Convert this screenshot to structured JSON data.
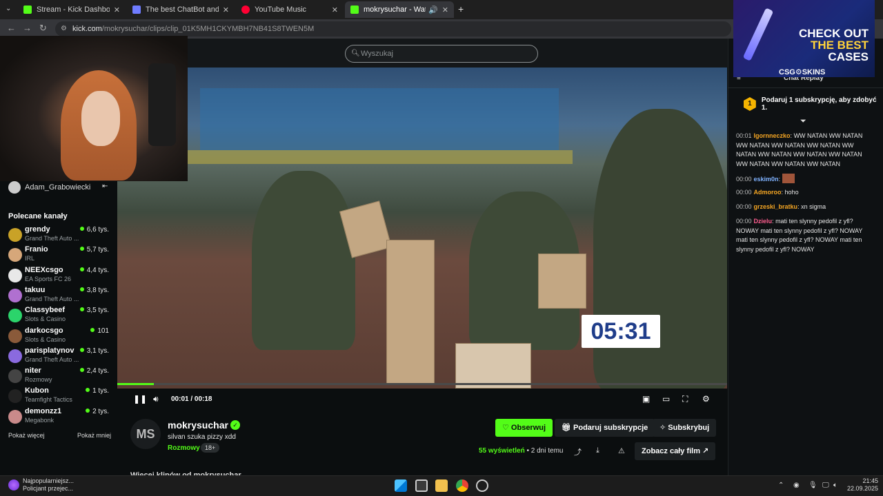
{
  "browser": {
    "tabs": [
      {
        "title": "Stream - Kick Dashboard",
        "favicon_color": "#53fc18",
        "active": false
      },
      {
        "title": "The best ChatBot and Widgets",
        "favicon_color": "#6f7cff",
        "active": false
      },
      {
        "title": "YouTube Music",
        "favicon_color": "#ff0033",
        "active": false
      },
      {
        "title": "mokrysuchar - Watch clips",
        "favicon_color": "#53fc18",
        "active": true
      }
    ],
    "url_host": "kick.com",
    "url_path": "/mokrysuchar/clips/clip_01K5MH1CKYMBH7NB41S8TWEN5M"
  },
  "search": {
    "placeholder": "Wyszukaj"
  },
  "sidebar": {
    "user": "Adam_Grabowiecki",
    "recommended_title": "Polecane kanały",
    "channels": [
      {
        "name": "grendy",
        "category": "Grand Theft Auto ...",
        "viewers": "6,6 tys.",
        "color": "#c9a227"
      },
      {
        "name": "Franio",
        "category": "IRL",
        "viewers": "5,7 tys.",
        "color": "#d6a77a"
      },
      {
        "name": "NEEXcsgo",
        "category": "EA Sports FC 26",
        "viewers": "4,4 tys.",
        "color": "#e8e8e8"
      },
      {
        "name": "takuu",
        "category": "Grand Theft Auto ...",
        "viewers": "3,8 tys.",
        "color": "#b070d0"
      },
      {
        "name": "Classybeef",
        "category": "Slots & Casino",
        "viewers": "3,5 tys.",
        "color": "#2bd46b"
      },
      {
        "name": "darkocsgo",
        "category": "Slots & Casino",
        "viewers": "101",
        "color": "#8a5a3a"
      },
      {
        "name": "parisplatynov",
        "category": "Grand Theft Auto ...",
        "viewers": "3,1 tys.",
        "color": "#8a6adf"
      },
      {
        "name": "niter",
        "category": "Rozmowy",
        "viewers": "2,4 tys.",
        "color": "#444444"
      },
      {
        "name": "Kubon",
        "category": "Teamfight Tactics",
        "viewers": "1 tys.",
        "color": "#222222"
      },
      {
        "name": "demonzz1",
        "category": "Megabonk",
        "viewers": "2 tys.",
        "color": "#c98a8a"
      }
    ],
    "show_more": "Pokaż więcej",
    "show_less": "Pokaż mniej"
  },
  "player": {
    "overlay_timer": "05:31",
    "current_time": "00:01",
    "separator": "/",
    "duration": "00:18",
    "progress": 0.06
  },
  "clip": {
    "channel_initials": "MS",
    "channel_name": "mokrysuchar",
    "title": "silvan szuka pizzy xdd",
    "category": "Rozmowy",
    "age_rating": "18+",
    "views_count": "55",
    "views_label": "wyświetleń",
    "age": "2 dni temu",
    "more_clips": "Więcej klipów od mokrysuchar"
  },
  "actions": {
    "follow": "Obserwuj",
    "gift": "Podaruj subskrypcje",
    "subscribe": "Subskrybuj",
    "watch_full": "Zobacz cały film"
  },
  "ad": {
    "line1": "CHECK OUT",
    "line2": "THE BEST",
    "line3": "CASES",
    "brand": "CSG⚙SKINS"
  },
  "chat": {
    "header": "Chat Replay",
    "gift_prompt": "Podaruj 1 subskrypcję, aby zdobyć 1.",
    "gift_number": "1",
    "messages": [
      {
        "time": "00:01",
        "user": "Igornneczko",
        "color": "#f5a623",
        "text": "WW NATAN WW NATAN WW NATAN WW NATAN WW NATAN WW NATAN WW NATAN WW NATAN WW NATAN WW NATAN WW NATAN WW NATAN"
      },
      {
        "time": "00:00",
        "user": "eskim0n",
        "color": "#7fb2ff",
        "text": ""
      },
      {
        "time": "00:00",
        "user": "Admoroo",
        "color": "#f5a623",
        "text": "hoho"
      },
      {
        "time": "00:00",
        "user": "grzeski_bratku",
        "color": "#f5a623",
        "text": "xn sigma"
      },
      {
        "time": "00:00",
        "user": "Dzielu",
        "color": "#ff5d8f",
        "text": "mati ten slynny pedofil z yfl? NOWAY mati ten slynny pedofil z yfl? NOWAY mati ten slynny pedofil z yfl? NOWAY mati ten slynny pedofil z yfl? NOWAY"
      }
    ]
  },
  "taskbar": {
    "weather_title": "Najpopularniejsz...",
    "weather_sub": "Policjant przejec...",
    "time": "21:45",
    "date": "22.09.2025"
  }
}
